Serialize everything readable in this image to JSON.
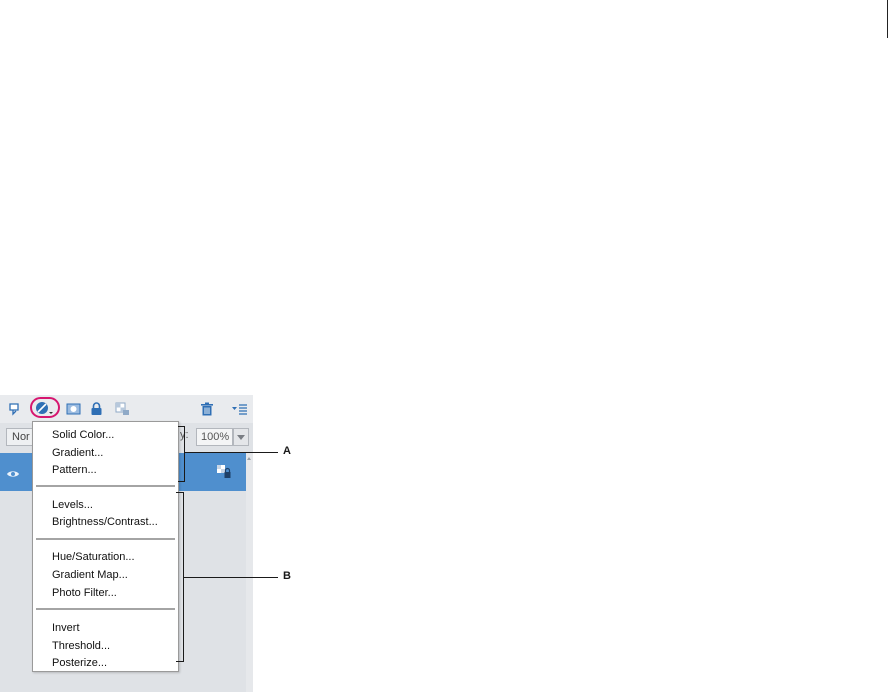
{
  "panel": {
    "blend_mode": "Nor",
    "opacity_label": "y:",
    "opacity_value": "100%"
  },
  "menu": {
    "items": [
      "Solid Color...",
      "Gradient...",
      "Pattern...",
      "Levels...",
      "Brightness/Contrast...",
      "Hue/Saturation...",
      "Gradient Map...",
      "Photo Filter...",
      "Invert",
      "Threshold...",
      "Posterize..."
    ]
  },
  "callouts": {
    "a": "A",
    "b": "B"
  },
  "colors": {
    "highlight_ring": "#d6166f",
    "selected_layer": "#4f8fce",
    "icon_blue": "#2f6fb5"
  }
}
